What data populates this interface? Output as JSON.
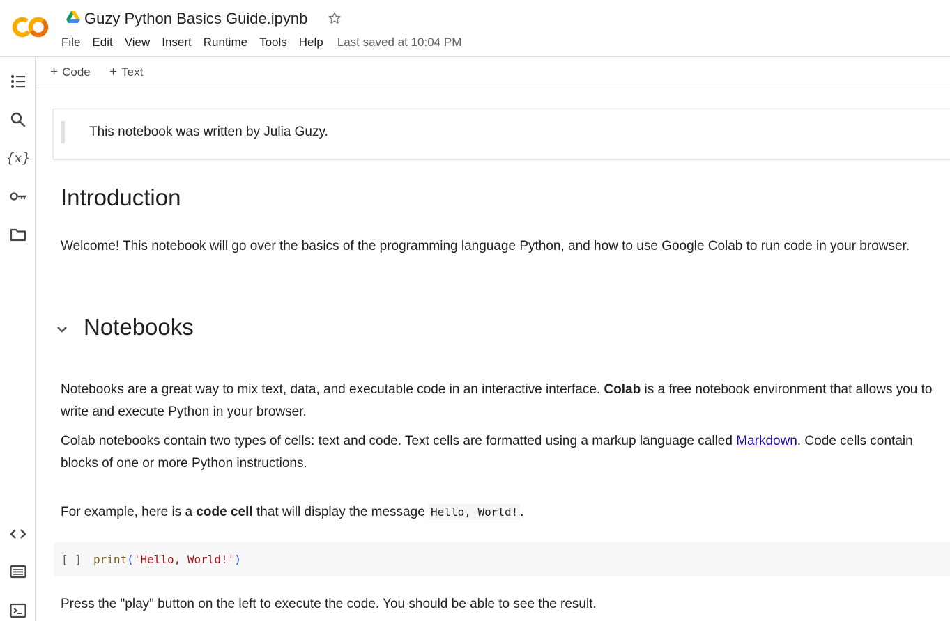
{
  "header": {
    "title": "Guzy Python Basics Guide.ipynb",
    "menu": [
      "File",
      "Edit",
      "View",
      "Insert",
      "Runtime",
      "Tools",
      "Help"
    ],
    "last_saved": "Last saved at 10:04 PM",
    "logo_text": "CO"
  },
  "toolbar": {
    "code_label": "Code",
    "text_label": "Text"
  },
  "rail": {
    "icons": [
      "table-of-contents-icon",
      "search-icon",
      "variables-icon",
      "secrets-key-icon",
      "files-folder-icon",
      "code-snippets-icon",
      "command-palette-icon",
      "terminal-icon"
    ],
    "variables_glyph": "{x}"
  },
  "notebook": {
    "quote_text": "This notebook was written by Julia Guzy.",
    "intro_heading": "Introduction",
    "intro_para": "Welcome! This notebook will go over the basics of the programming language Python, and how to use Google Colab to run code in your browser.",
    "notebooks_heading": "Notebooks",
    "p1_a": "Notebooks are a great way to mix text, data, and executable code in an interactive interface. ",
    "p1_bold": "Colab",
    "p1_b": " is a free notebook environment that allows you to write and execute Python in your browser.",
    "p2_a": "Colab notebooks contain two types of cells: text and code. Text cells are formatted using a markup language called ",
    "p2_link": "Markdown",
    "p2_b": ". Code cells contain blocks of one or more Python instructions.",
    "p3_a": "For example, here is a ",
    "p3_bold": "code cell",
    "p3_b": " that will display the message ",
    "p3_code": "Hello, World!",
    "p3_c": ".",
    "code_bracket": "[ ]",
    "code_fn": "print",
    "code_open": "(",
    "code_str": "'Hello, World!'",
    "code_close": ")",
    "p4": "Press the \"play\" button on the left to execute the code. You should be able to see the result."
  },
  "colors": {
    "logo_orange": "#f9ab00",
    "logo_dark_orange": "#e8710a",
    "link": "#1a0dab"
  }
}
